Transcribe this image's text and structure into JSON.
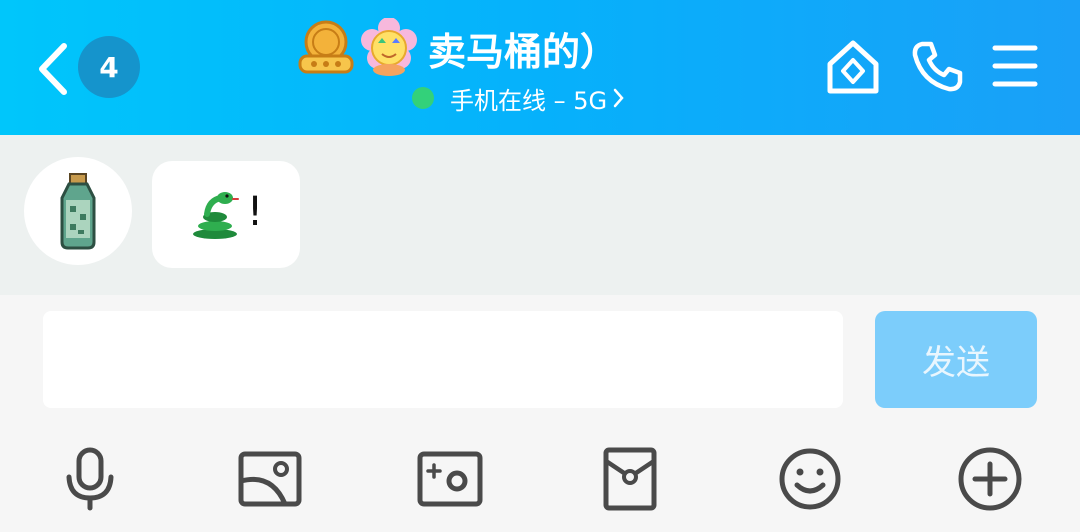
{
  "header": {
    "unread_count": "4",
    "title": "卖马桶的）",
    "status_text": "手机在线 – 5G"
  },
  "messages": [
    {
      "sender": "other",
      "text": "!",
      "emoji": "snake"
    }
  ],
  "composer": {
    "input_value": "",
    "send_label": "发送"
  },
  "toolbar": [
    {
      "icon": "microphone-icon"
    },
    {
      "icon": "image-icon"
    },
    {
      "icon": "camera-icon"
    },
    {
      "icon": "red-packet-icon"
    },
    {
      "icon": "emoji-icon"
    },
    {
      "icon": "plus-icon"
    }
  ],
  "colors": {
    "header_start": "#00c6fb",
    "header_end": "#1aa0f8",
    "online_dot": "#33d17a",
    "send_button": "#7ccdfb",
    "chat_background": "#edf1f0"
  }
}
